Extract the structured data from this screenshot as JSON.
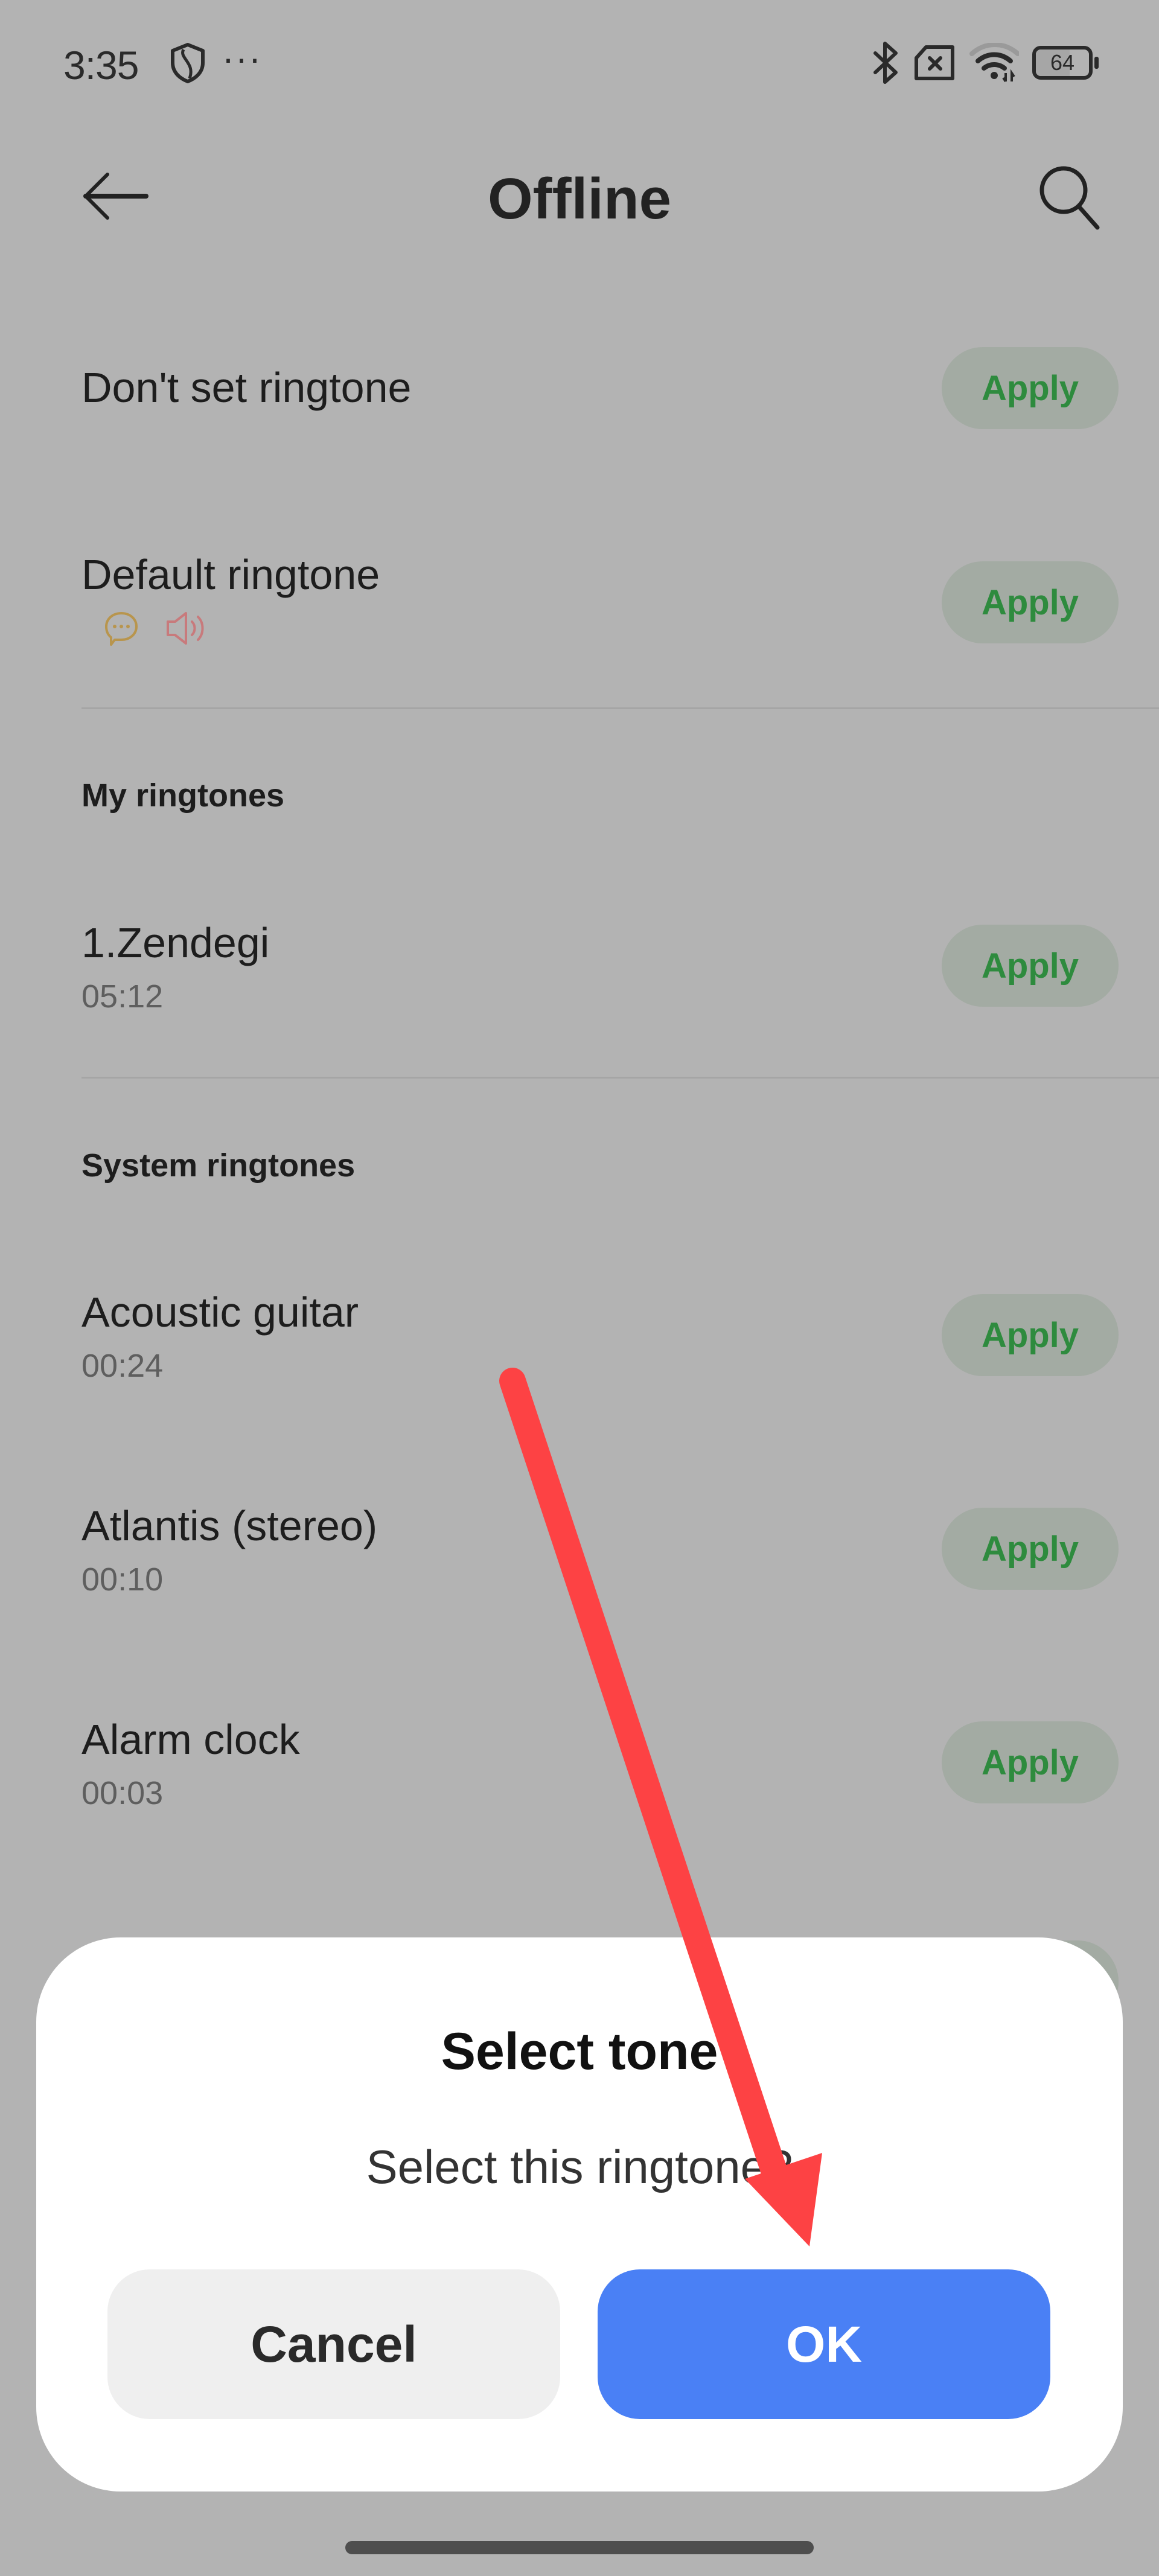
{
  "status_bar": {
    "time": "3:35",
    "more_indicator": "···",
    "battery_level": "64",
    "battery_fraction": 0.64,
    "icons": [
      "shield-icon",
      "bluetooth-icon",
      "no-sim-icon",
      "wifi-icon",
      "battery-icon"
    ]
  },
  "app_bar": {
    "title": "Offline",
    "back_icon": "arrow-left-icon",
    "search_icon": "search-icon"
  },
  "list": {
    "top_items": [
      {
        "title": "Don't set ringtone",
        "action": "Apply"
      },
      {
        "title": "Default ringtone",
        "action": "Apply",
        "icons": [
          "message-icon",
          "speaker-icon"
        ]
      }
    ],
    "sections": [
      {
        "header": "My ringtones",
        "items": [
          {
            "title": "1.Zendegi",
            "duration": "05:12",
            "action": "Apply"
          }
        ]
      },
      {
        "header": "System ringtones",
        "items": [
          {
            "title": "Acoustic guitar",
            "duration": "00:24",
            "action": "Apply"
          },
          {
            "title": "Atlantis (stereo)",
            "duration": "00:10",
            "action": "Apply"
          },
          {
            "title": "Alarm clock",
            "duration": "00:03",
            "action": "Apply"
          }
        ]
      }
    ]
  },
  "dialog": {
    "title": "Select tone",
    "message": "Select this ringtone?",
    "cancel_label": "Cancel",
    "ok_label": "OK"
  },
  "colors": {
    "scrim_background": "#b3b3b3",
    "apply_text": "#2e8b3e",
    "apply_bg": "#a3aba3",
    "ok_button": "#4a80f5",
    "cancel_button": "#efefef",
    "annotation_arrow": "#fd4244",
    "message_icon": "#b8954d",
    "speaker_icon": "#c87a7c"
  }
}
